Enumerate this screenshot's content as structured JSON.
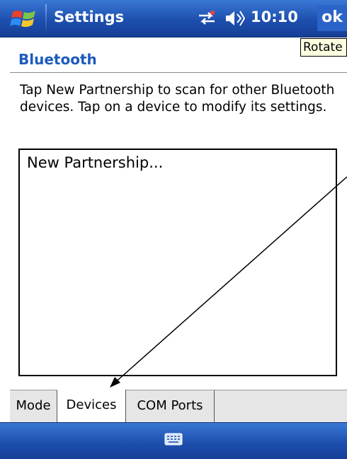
{
  "titlebar": {
    "title": "Settings",
    "clock": "10:10",
    "ok_label": "ok",
    "icons": [
      "windows-start-flag-icon",
      "connectivity-icon",
      "volume-icon"
    ]
  },
  "tooltip": "Rotate",
  "page": {
    "header": "Bluetooth",
    "instructions": "Tap New Partnership to scan for other Bluetooth devices. Tap on a device to modify its settings.",
    "list_items": [
      "New Partnership..."
    ]
  },
  "tabs": [
    {
      "label": "Mode",
      "active": false
    },
    {
      "label": "Devices",
      "active": true
    },
    {
      "label": "COM Ports",
      "active": false
    }
  ],
  "bottombar": {
    "icon": "keyboard-icon"
  },
  "colors": {
    "titlebar": "#1d4fae",
    "header_text": "#1e5bbd",
    "tooltip_bg": "#ffffe1"
  }
}
